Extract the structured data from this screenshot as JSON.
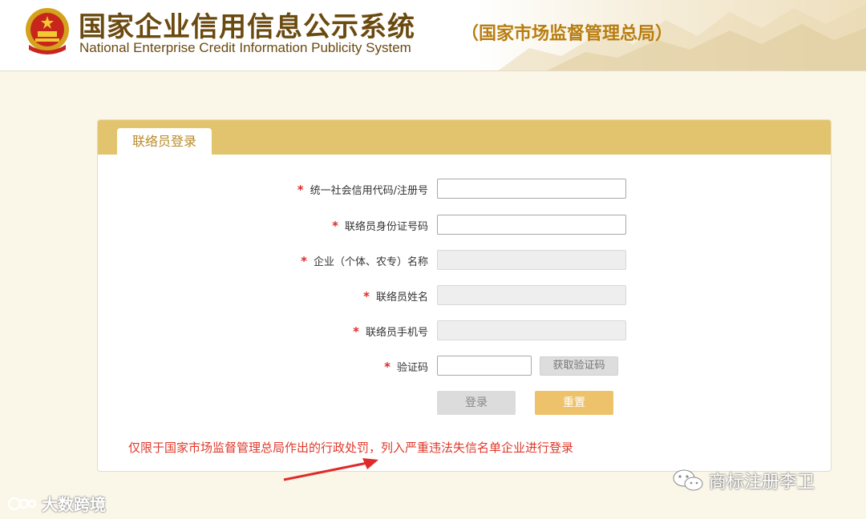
{
  "header": {
    "title_cn": "国家企业信用信息公示系统",
    "title_en": "National Enterprise Credit Information Publicity System",
    "subtitle": "（国家市场监督管理总局）",
    "emblem_icon": "national-emblem-icon"
  },
  "panel": {
    "tab_label": "联络员登录",
    "fields": [
      {
        "label": "统一社会信用代码/注册号",
        "value": "",
        "enabled": true
      },
      {
        "label": "联络员身份证号码",
        "value": "",
        "enabled": true
      },
      {
        "label": "企业（个体、农专）名称",
        "value": "",
        "enabled": false
      },
      {
        "label": "联络员姓名",
        "value": "",
        "enabled": false
      },
      {
        "label": "联络员手机号",
        "value": "",
        "enabled": false
      },
      {
        "label": "验证码",
        "value": "",
        "enabled": true
      }
    ],
    "required_mark": "*",
    "get_code_label": "获取验证码",
    "login_label": "登录",
    "reset_label": "重置",
    "notice": "仅限于国家市场监督管理总局作出的行政处罚，列入严重违法失信名单企业进行登录"
  },
  "watermarks": {
    "left_text": "大数跨境",
    "right_text": "商标注册李卫"
  },
  "colors": {
    "header_gold": "#e3c46e",
    "title_brown": "#6b4a10",
    "subtitle_gold": "#b87d10",
    "notice_red": "#e0382b",
    "reset_button": "#edc26a"
  }
}
